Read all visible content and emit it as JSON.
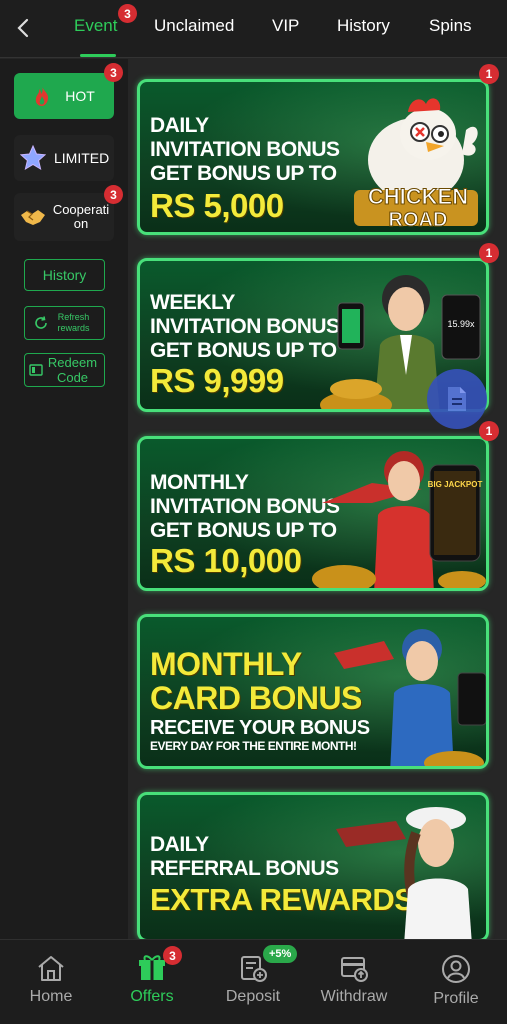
{
  "tabs": [
    {
      "label": "Event",
      "badge": "3",
      "active": true
    },
    {
      "label": "Unclaimed"
    },
    {
      "label": "VIP"
    },
    {
      "label": "History"
    },
    {
      "label": "Spins"
    }
  ],
  "sidebar": {
    "categories": [
      {
        "label": "HOT",
        "badge": "3",
        "icon": "flame-icon",
        "active": true
      },
      {
        "label": "LIMITED",
        "icon": "star-icon"
      },
      {
        "label": "Cooperati on",
        "badge": "3",
        "icon": "handshake-icon"
      }
    ],
    "history_label": "History",
    "refresh_label": "Refresh rewards",
    "redeem_label": "Redeem Code"
  },
  "banners": [
    {
      "badge": "1",
      "lines": [
        "DAILY",
        "INVITATION BONUS",
        "GET BONUS UP TO"
      ],
      "amount": "RS 5,000",
      "logo": "CHICKEN ROAD"
    },
    {
      "badge": "1",
      "lines": [
        "WEEKLY",
        "INVITATION BONUS",
        "GET BONUS UP TO"
      ],
      "amount": "RS 9,999",
      "screen_text": "15.99x"
    },
    {
      "badge": "1",
      "lines": [
        "MONTHLY",
        "INVITATION BONUS",
        "GET BONUS UP TO"
      ],
      "amount": "RS 10,000",
      "phone_text": "BIG JACKPOT"
    },
    {
      "big_lines": [
        "MONTHLY",
        "CARD BONUS"
      ],
      "lines": [
        "RECEIVE YOUR BONUS"
      ],
      "small": "EVERY DAY FOR THE ENTIRE MONTH!"
    },
    {
      "lines": [
        "DAILY",
        "REFERRAL BONUS"
      ],
      "big_lines": [
        "EXTRA REWARDS"
      ]
    }
  ],
  "bottom_nav": [
    {
      "label": "Home",
      "icon": "home-icon"
    },
    {
      "label": "Offers",
      "icon": "gift-icon",
      "badge": "3",
      "active": true
    },
    {
      "label": "Deposit",
      "icon": "deposit-icon",
      "tag": "+5%"
    },
    {
      "label": "Withdraw",
      "icon": "withdraw-icon"
    },
    {
      "label": "Profile",
      "icon": "profile-icon"
    }
  ],
  "colors": {
    "accent": "#2ecc5a",
    "badge": "#d62d32",
    "banner_border": "#48e07a",
    "amount_yellow": "#f3ea3a"
  }
}
